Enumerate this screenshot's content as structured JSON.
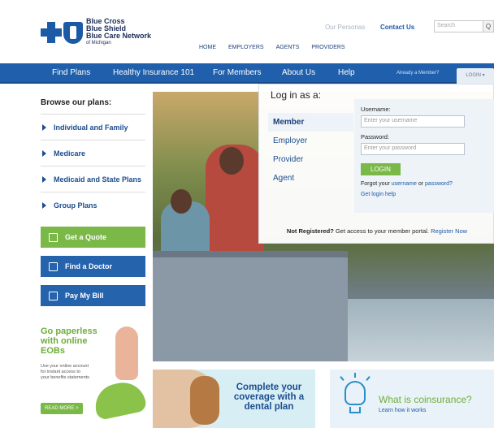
{
  "header": {
    "logo_lines": [
      "Blue Cross",
      "Blue Shield",
      "Blue Care Network",
      "of Michigan"
    ],
    "our_personas": "Our Personas",
    "contact_us": "Contact Us",
    "search_placeholder": "Search",
    "top_nav": [
      "HOME",
      "EMPLOYERS",
      "AGENTS",
      "PROVIDERS"
    ]
  },
  "main_nav": {
    "items": [
      "Find Plans",
      "Healthy Insurance 101",
      "For Members",
      "About Us",
      "Help"
    ],
    "already_member": "Already a Member?",
    "login_tab": "LOGIN ▾"
  },
  "sidebar": {
    "browse_title": "Browse our plans:",
    "plans": [
      "Individual and Family",
      "Medicare",
      "Medicaid and State Plans",
      "Group Plans"
    ],
    "buttons": {
      "quote": "Get a Quote",
      "doctor": "Find a Doctor",
      "bill": "Pay My Bill"
    },
    "paperless": {
      "title": "Go paperless with online EOBs",
      "body": "Use your online account for instant access to your benefits statements",
      "read_more": "READ MORE >"
    }
  },
  "login": {
    "title": "Log in as a:",
    "roles": [
      "Member",
      "Employer",
      "Provider",
      "Agent"
    ],
    "username_label": "Username:",
    "username_placeholder": "Enter your username",
    "password_label": "Password:",
    "password_placeholder": "Enter your password",
    "login_button": "LOGIN",
    "forgot_prefix": "Forgot your",
    "forgot_username": "username",
    "forgot_or": "or",
    "forgot_password": "password?",
    "help": "Get login help",
    "not_registered_bold": "Not Registered?",
    "not_registered_text": "Get access to your member portal.",
    "register_now": "Register Now"
  },
  "promos": {
    "dental": "Complete your coverage with a dental plan",
    "coinsurance_title": "What is coinsurance?",
    "coinsurance_sub": "Learn how it works"
  },
  "colors": {
    "brand_blue": "#1f5fab",
    "accent_green": "#7ab848",
    "link_blue": "#1c5aa6"
  }
}
